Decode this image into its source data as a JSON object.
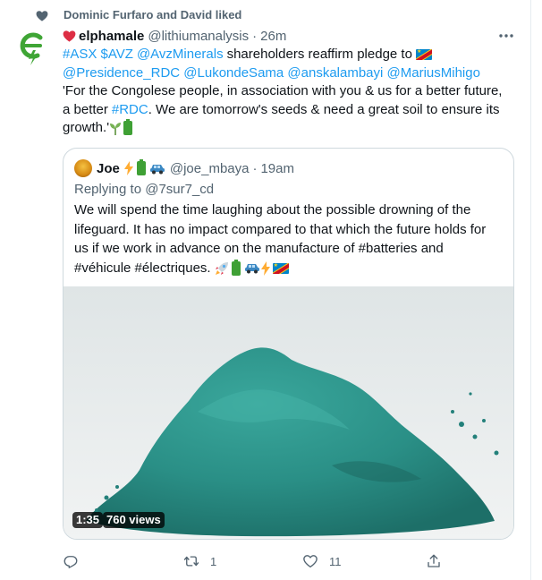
{
  "social_context": {
    "text": "Dominic Furfaro and David liked"
  },
  "tweet": {
    "display_name": "elphamale",
    "handle": "@lithiumanalysis",
    "separator": "·",
    "time": "26m",
    "line1": {
      "cashtags": "#ASX $AVZ",
      "mention": "@AvzMinerals",
      "text": "shareholders reaffirm pledge to"
    },
    "line2": {
      "mentions": "@Presidence_RDC @LukondeSama @anskalambayi @MariusMihigo"
    },
    "line3": {
      "text": "'For the Congolese people, in association with you & us for a better future,"
    },
    "line4": {
      "pre": "a better",
      "hashtag": "#RDC",
      "post": ". We are tomorrow's seeds & need a great soil to ensure its"
    },
    "line5": {
      "text": "growth.'"
    }
  },
  "quoted_tweet": {
    "display_name": "Joe",
    "handle": "@joe_mbaya",
    "separator": "·",
    "time": "19am",
    "replying_to": "Replying to @7sur7_cd",
    "lines": [
      "We will spend the time laughing about the possible drowning of the",
      "lifeguard. It has no impact compared to that which the future holds for",
      "us if we work in advance on the manufacture of #batteries and",
      "#véhicule #électriques."
    ],
    "video": {
      "duration": "1:35",
      "views": "760 views"
    }
  },
  "actions": {
    "reply_count": "",
    "retweet_count": "1",
    "like_count": "11",
    "share_count": ""
  },
  "colors": {
    "link": "#1d9bf0",
    "secondary_text": "#536471",
    "border": "#cfd9de",
    "brand_green": "#3fa535",
    "powder": "#2a8f86"
  }
}
